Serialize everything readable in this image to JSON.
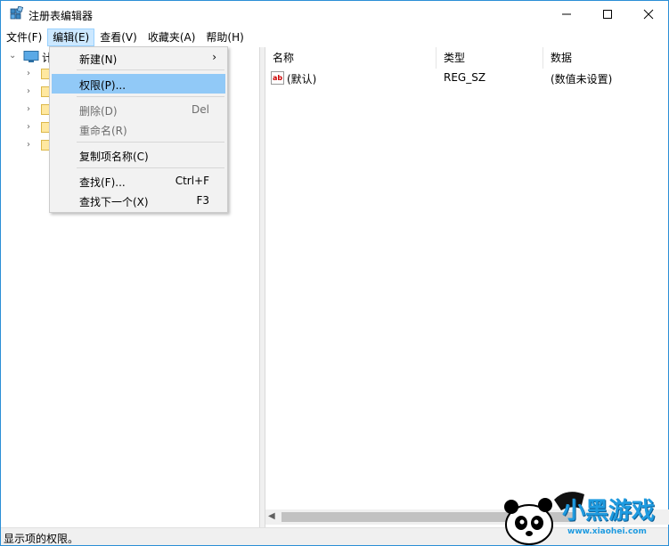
{
  "window": {
    "title": "注册表编辑器",
    "accent_color": "#2b8fd6"
  },
  "menubar": {
    "items": [
      {
        "label": "文件(F)"
      },
      {
        "label": "编辑(E)"
      },
      {
        "label": "查看(V)"
      },
      {
        "label": "收藏夹(A)"
      },
      {
        "label": "帮助(H)"
      }
    ]
  },
  "tree": {
    "root_label": "计"
  },
  "list": {
    "columns": [
      {
        "label": "名称"
      },
      {
        "label": "类型"
      },
      {
        "label": "数据"
      }
    ],
    "rows": [
      {
        "name": "(默认)",
        "type": "REG_SZ",
        "data": "(数值未设置)",
        "icon": "string-value-icon"
      }
    ]
  },
  "edit_menu": {
    "items": [
      {
        "label": "新建(N)",
        "shortcut": "",
        "submenu": true
      },
      {
        "label": "权限(P)...",
        "shortcut": ""
      },
      {
        "label": "删除(D)",
        "shortcut": "Del",
        "disabled": true
      },
      {
        "label": "重命名(R)",
        "shortcut": "",
        "disabled": true
      },
      {
        "label": "复制项名称(C)",
        "shortcut": ""
      },
      {
        "label": "查找(F)...",
        "shortcut": "Ctrl+F"
      },
      {
        "label": "查找下一个(X)",
        "shortcut": "F3"
      }
    ],
    "highlight_color": "#91c9f7"
  },
  "status": {
    "text": "显示项的权限。"
  },
  "watermark": {
    "brand": "小黑游戏",
    "url": "www.xiaohei.com"
  }
}
